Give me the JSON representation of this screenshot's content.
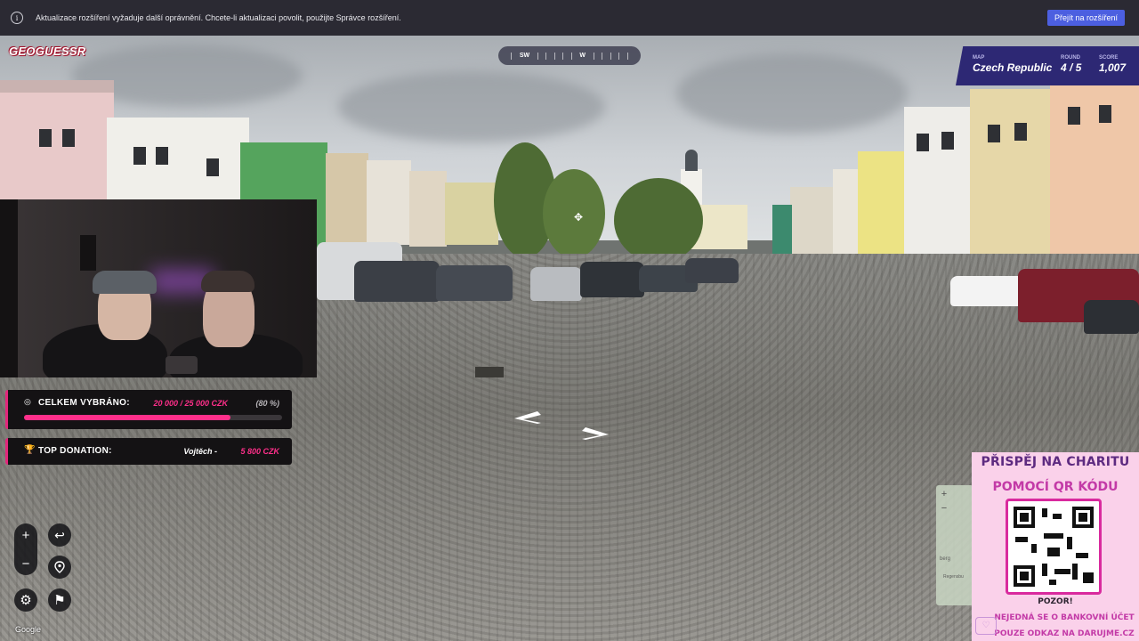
{
  "extension_bar": {
    "message": "Aktualizace rozšíření vyžaduje další oprávnění. Chcete-li aktualizaci povolit, použijte Správce rozšíření.",
    "button_label": "Přejít na rozšíření"
  },
  "game": {
    "logo": "GEOGUESSR",
    "compass": {
      "sw": "SW",
      "w": "W"
    },
    "map_label": "MAP",
    "map_value": "Czech Republic",
    "round_label": "ROUND",
    "round_value": "4 / 5",
    "score_label": "SCORE",
    "score_value": "1,007",
    "google": "Google"
  },
  "donations": {
    "total_label": "CELKEM VYBRÁNO:",
    "total_value": "20 000 / 25 000 CZK",
    "total_percent": "(80 %)",
    "progress_fraction": 0.8,
    "top_label": "TOP DONATION:",
    "top_name": "Vojtěch -",
    "top_value": "5 800 CZK"
  },
  "minimap": {
    "town1": "berg",
    "town2": "Regensbu"
  },
  "charity": {
    "heading1": "PŘISPĚJ NA CHARITU",
    "heading2": "POMOCÍ QR KÓDU",
    "warn": "POZOR!",
    "line1": "NEJEDNÁ SE O BANKOVNÍ ÚČET",
    "line2": "POUZE ODKAZ NA DARUJME.CZ"
  },
  "colors": {
    "accent_pink": "#ff2f8a",
    "panel_purple": "#2d2874",
    "button_blue": "#4c5fe0"
  },
  "icons": [
    "info-icon",
    "zoom-in-icon",
    "zoom-out-icon",
    "undo-icon",
    "pin-icon",
    "settings-icon",
    "flag-icon",
    "trophy-icon",
    "target-icon"
  ]
}
